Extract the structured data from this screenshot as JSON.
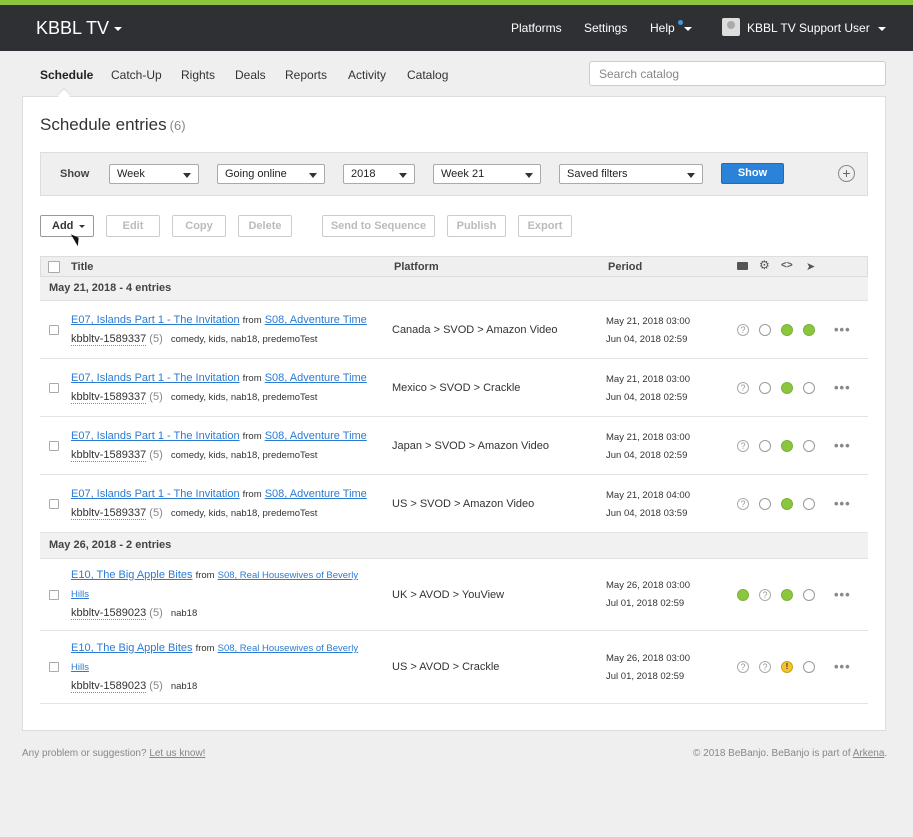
{
  "app": {
    "brand": "KBBL TV",
    "top_nav": [
      "Platforms",
      "Settings",
      "Help"
    ],
    "user": "KBBL TV Support User"
  },
  "subnav": [
    "Schedule",
    "Catch-Up",
    "Rights",
    "Deals",
    "Reports",
    "Activity",
    "Catalog"
  ],
  "search": {
    "placeholder": "Search catalog"
  },
  "page": {
    "title": "Schedule entries",
    "count": "(6)"
  },
  "filters": {
    "label": "Show",
    "selects": [
      "Week",
      "Going online",
      "2018",
      "Week 21",
      "Saved filters"
    ],
    "show_button": "Show"
  },
  "actions": [
    "Add",
    "Edit",
    "Copy",
    "Delete",
    "Send to Sequence",
    "Publish",
    "Export"
  ],
  "table": {
    "columns": [
      "Title",
      "Platform",
      "Period"
    ]
  },
  "groups": [
    {
      "label": "May 21, 2018 - 4 entries",
      "entries": [
        {
          "title": "E07, Islands Part 1 - The Invitation",
          "from": "from",
          "series": "S08, Adventure Time",
          "id": "kbbltv-1589337",
          "count": "(5)",
          "tags": "comedy, kids, nab18, predemoTest",
          "platform": "Canada > SVOD > Amazon Video",
          "start": "May 21, 2018 03:00",
          "end": "Jun 04, 2018 02:59",
          "status": [
            "q",
            "e",
            "g",
            "g"
          ]
        },
        {
          "title": "E07, Islands Part 1 - The Invitation",
          "from": "from",
          "series": "S08, Adventure Time",
          "id": "kbbltv-1589337",
          "count": "(5)",
          "tags": "comedy, kids, nab18, predemoTest",
          "platform": "Mexico > SVOD > Crackle",
          "start": "May 21, 2018 03:00",
          "end": "Jun 04, 2018 02:59",
          "status": [
            "q",
            "e",
            "g",
            "e"
          ]
        },
        {
          "title": "E07, Islands Part 1 - The Invitation",
          "from": "from",
          "series": "S08, Adventure Time",
          "id": "kbbltv-1589337",
          "count": "(5)",
          "tags": "comedy, kids, nab18, predemoTest",
          "platform": "Japan > SVOD > Amazon Video",
          "start": "May 21, 2018 03:00",
          "end": "Jun 04, 2018 02:59",
          "status": [
            "q",
            "e",
            "g",
            "e"
          ]
        },
        {
          "title": "E07, Islands Part 1 - The Invitation",
          "from": "from",
          "series": "S08, Adventure Time",
          "id": "kbbltv-1589337",
          "count": "(5)",
          "tags": "comedy, kids, nab18, predemoTest",
          "platform": "US > SVOD > Amazon Video",
          "start": "May 21, 2018 04:00",
          "end": "Jun 04, 2018 03:59",
          "status": [
            "q",
            "e",
            "g",
            "e"
          ]
        }
      ]
    },
    {
      "label": "May 26, 2018 - 2 entries",
      "entries": [
        {
          "title": "E10, The Big Apple Bites",
          "from": "from",
          "series_line1": "S08, Real Housewives of Beverly",
          "series_line2": "Hills",
          "id": "kbbltv-1589023",
          "count": "(5)",
          "tags": "nab18",
          "platform": "UK > AVOD > YouView",
          "start": "May 26, 2018 03:00",
          "end": "Jul 01, 2018 02:59",
          "status": [
            "g",
            "q",
            "g",
            "e"
          ]
        },
        {
          "title": "E10, The Big Apple Bites",
          "from": "from",
          "series_line1": "S08, Real Housewives of Beverly",
          "series_line2": "Hills",
          "id": "kbbltv-1589023",
          "count": "(5)",
          "tags": "nab18",
          "platform": "US > AVOD > Crackle",
          "start": "May 26, 2018 03:00",
          "end": "Jul 01, 2018 02:59",
          "status": [
            "q",
            "q",
            "w",
            "e"
          ]
        }
      ]
    }
  ],
  "footer": {
    "left": "Any problem or suggestion?",
    "left_link": "Let us know!",
    "right": "© 2018 BeBanjo. BeBanjo is part of",
    "right_link": "Arkena",
    "right_end": "."
  },
  "colors": {
    "topbar": "#2f3034",
    "accent": "#8cc63f",
    "primary": "#2b82d9",
    "link": "#2b7bd3"
  }
}
